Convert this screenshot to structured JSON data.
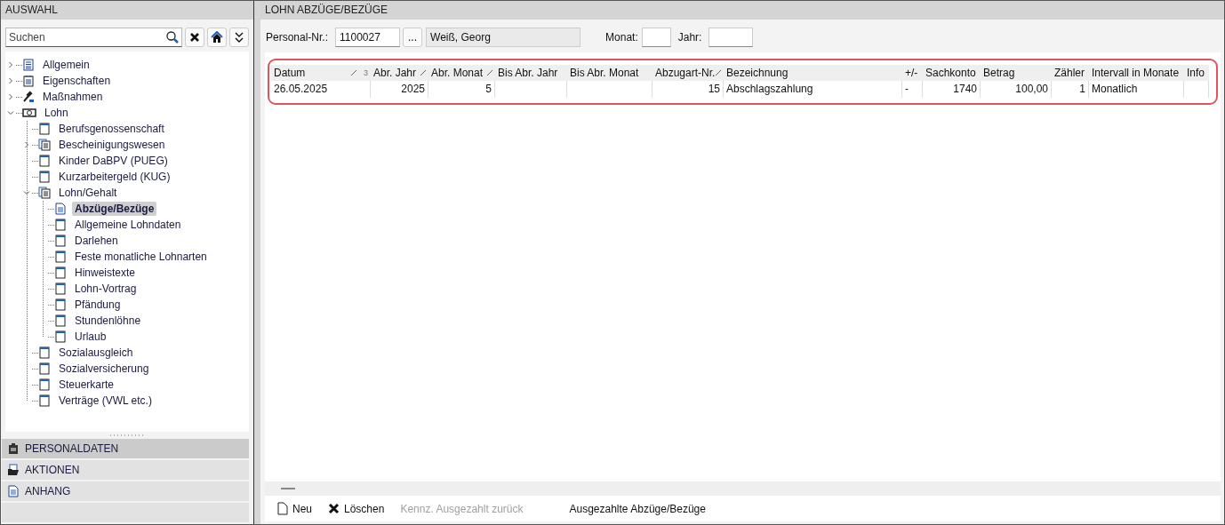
{
  "left_panel": {
    "title": "AUSWAHL",
    "search": {
      "placeholder": "Suchen"
    },
    "tree": [
      {
        "label": "Allgemein",
        "kind": "list",
        "expanded": false,
        "selected": false
      },
      {
        "label": "Eigenschaften",
        "kind": "notepad",
        "expanded": false,
        "selected": false
      },
      {
        "label": "Maßnahmen",
        "kind": "gavel",
        "expanded": false,
        "selected": false
      },
      {
        "label": "Lohn",
        "kind": "money",
        "expanded": true,
        "selected": false,
        "children": [
          {
            "label": "Berufsgenossenschaft",
            "kind": "page",
            "selected": false
          },
          {
            "label": "Bescheinigungswesen",
            "kind": "pages",
            "expanded": false,
            "selected": false
          },
          {
            "label": "Kinder DaBPV (PUEG)",
            "kind": "page",
            "selected": false
          },
          {
            "label": "Kurzarbeitergeld (KUG)",
            "kind": "page",
            "selected": false
          },
          {
            "label": "Lohn/Gehalt",
            "kind": "pages",
            "expanded": true,
            "selected": false,
            "children": [
              {
                "label": "Abzüge/Bezüge",
                "kind": "doc",
                "selected": true
              },
              {
                "label": "Allgemeine Lohndaten",
                "kind": "page",
                "selected": false
              },
              {
                "label": "Darlehen",
                "kind": "page",
                "selected": false
              },
              {
                "label": "Feste monatliche Lohnarten",
                "kind": "page",
                "selected": false
              },
              {
                "label": "Hinweistexte",
                "kind": "page",
                "selected": false
              },
              {
                "label": "Lohn-Vortrag",
                "kind": "page",
                "selected": false
              },
              {
                "label": "Pfändung",
                "kind": "page",
                "selected": false
              },
              {
                "label": "Stundenlöhne",
                "kind": "page",
                "selected": false
              },
              {
                "label": "Urlaub",
                "kind": "page",
                "selected": false
              }
            ]
          },
          {
            "label": "Sozialausgleich",
            "kind": "page",
            "selected": false
          },
          {
            "label": "Sozialversicherung",
            "kind": "page",
            "selected": false
          },
          {
            "label": "Steuerkarte",
            "kind": "page",
            "selected": false
          },
          {
            "label": "Verträge (VWL etc.)",
            "kind": "page",
            "selected": false
          }
        ]
      }
    ],
    "sections": [
      {
        "label": "PERSONALDATEN",
        "kind": "clipboard",
        "selected": true
      },
      {
        "label": "AKTIONEN",
        "kind": "folder",
        "selected": false
      },
      {
        "label": "ANHANG",
        "kind": "doc",
        "selected": false
      }
    ]
  },
  "main": {
    "title": "LOHN ABZÜGE/BEZÜGE",
    "form": {
      "personal_label": "Personal-Nr.:",
      "personal_value": "1100027",
      "browse": "...",
      "name_value": "Weiß, Georg",
      "month_label": "Monat:",
      "year_label": "Jahr:"
    },
    "table": {
      "columns": [
        {
          "label": "Datum",
          "sorted": true,
          "sort_order": "3"
        },
        {
          "label": "Abr. Jahr",
          "sorted": true
        },
        {
          "label": "Abr. Monat",
          "sorted": true
        },
        {
          "label": "Bis Abr. Jahr",
          "sorted": false
        },
        {
          "label": "Bis Abr. Monat",
          "sorted": false
        },
        {
          "label": "Abzugart-Nr.",
          "sorted": true
        },
        {
          "label": "Bezeichnung",
          "sorted": false
        },
        {
          "label": "+/-",
          "sorted": false
        },
        {
          "label": "Sachkonto",
          "sorted": false
        },
        {
          "label": "Betrag",
          "sorted": false
        },
        {
          "label": "Zähler",
          "sorted": false
        },
        {
          "label": "Intervall in Monate",
          "sorted": false
        },
        {
          "label": "Info",
          "sorted": false
        }
      ],
      "rows": [
        [
          "26.05.2025",
          "2025",
          "5",
          "",
          "",
          "15",
          "Abschlagszahlung",
          "-",
          "1740",
          "100,00",
          "1",
          "Monatlich",
          ""
        ]
      ]
    },
    "toolbar": [
      {
        "label": "Neu",
        "kind": "new",
        "disabled": false
      },
      {
        "label": "Löschen",
        "kind": "delete",
        "disabled": false
      },
      {
        "label": "Kennz. Ausgezahlt zurück",
        "kind": "plain",
        "disabled": true
      },
      {
        "label": "Ausgezahlte Abzüge/Bezüge",
        "kind": "plain",
        "disabled": false
      }
    ]
  }
}
